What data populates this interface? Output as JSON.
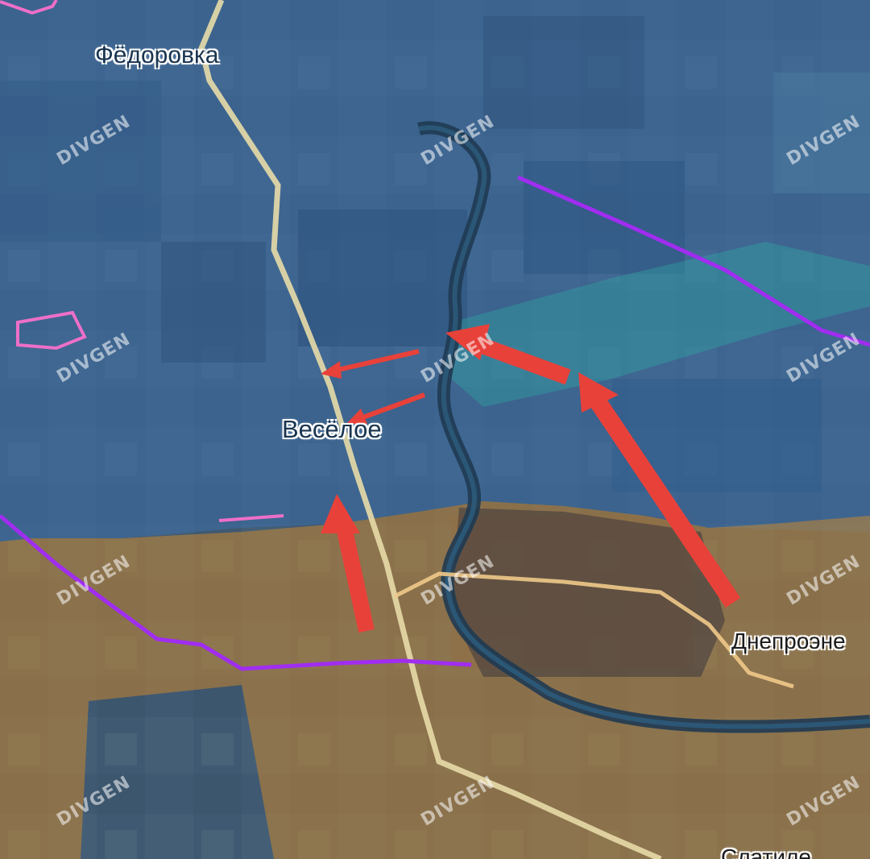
{
  "map": {
    "labels": {
      "fedorovka": "Фёдоровка",
      "veseloe": "Весёлое",
      "dneproenergiya": "Днепроэне",
      "bottom_partial": "Слатиле"
    },
    "watermark": "DIVGEN",
    "colors": {
      "ukraine_zone": "#3a74b6",
      "russia_zone": "#c8862e",
      "contested_zone": "#2fb3a6",
      "front_line": "#a02df0",
      "attack_arrow": "#e8413a",
      "outline_pink": "#ee6fc8",
      "road": "#e8dca8"
    },
    "icons": [
      "attack-arrow",
      "front-line",
      "pink-outline"
    ]
  }
}
